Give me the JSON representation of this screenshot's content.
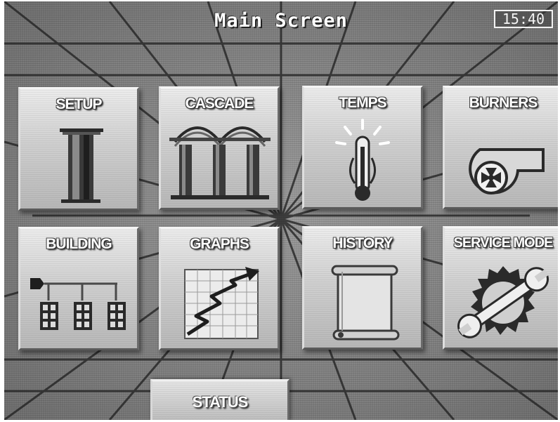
{
  "header": {
    "title": "Main Screen",
    "clock": "15:40"
  },
  "tiles": [
    {
      "label": "SETUP",
      "icon": "column-icon"
    },
    {
      "label": "CASCADE",
      "icon": "cascade-columns-icon"
    },
    {
      "label": "TEMPS",
      "icon": "thermometer-icon"
    },
    {
      "label": "BURNERS",
      "icon": "blower-fan-icon"
    },
    {
      "label": "BUILDING",
      "icon": "building-windows-icon"
    },
    {
      "label": "GRAPHS",
      "icon": "graph-trend-icon"
    },
    {
      "label": "HISTORY",
      "icon": "scroll-icon"
    },
    {
      "label": "SERVICE MODE",
      "icon": "wrench-gear-icon"
    }
  ],
  "footer": {
    "status_label": "STATUS"
  },
  "colors": {
    "background": "#7c7c7c",
    "tile_face": "#d0d0d0",
    "text": "#ffffff"
  }
}
